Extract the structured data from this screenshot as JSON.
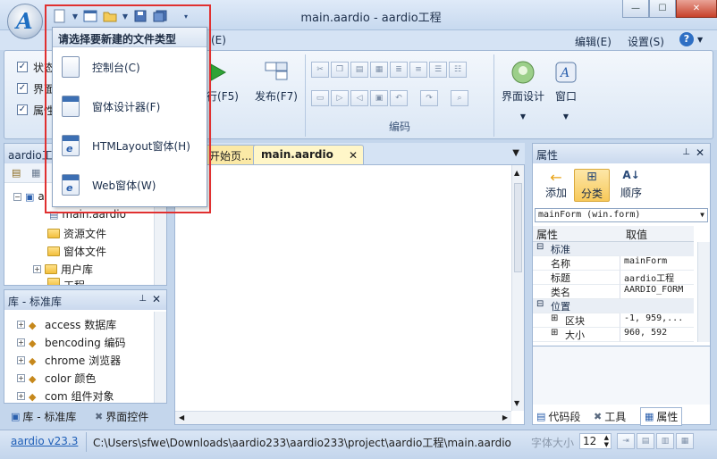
{
  "window": {
    "title": "main.aardio - aardio工程"
  },
  "menu_right": {
    "edit": "编辑(E)",
    "settings": "设置(S)",
    "help_icon": "help-icon"
  },
  "menu_partial": "(E)",
  "ribbon": {
    "view_checks": [
      {
        "label": "状态",
        "checked": true
      },
      {
        "label": "界面",
        "checked": true
      },
      {
        "label": "属性",
        "checked": true
      }
    ],
    "run_label": "运行(F5)",
    "publish_label": "发布(F7)",
    "code_group_label": "编码",
    "ui_design_label": "界面设计",
    "window_label": "窗口"
  },
  "new_dropdown": {
    "header": "请选择要新建的文件类型",
    "items": [
      {
        "label": "控制台(C)",
        "icon": "console-icon"
      },
      {
        "label": "窗体设计器(F)",
        "icon": "form-designer-icon"
      },
      {
        "label": "HTMLayout窗体(H)",
        "icon": "htmlayout-icon"
      },
      {
        "label": "Web窗体(W)",
        "icon": "web-form-icon"
      }
    ]
  },
  "project_panel": {
    "title": "aardio工",
    "tree": [
      {
        "label": "a",
        "type": "project"
      },
      {
        "label": "main.aardio",
        "type": "file"
      },
      {
        "label": "资源文件",
        "type": "folder"
      },
      {
        "label": "窗体文件",
        "type": "folder"
      },
      {
        "label": "用户库",
        "type": "folder"
      },
      {
        "label": "工程",
        "type": "folder"
      }
    ]
  },
  "library_panel": {
    "title": "库 - 标准库",
    "items": [
      {
        "label": "access 数据库"
      },
      {
        "label": "bencoding 编码"
      },
      {
        "label": "chrome 浏览器"
      },
      {
        "label": "color 颜色"
      },
      {
        "label": "com 组件对象"
      }
    ],
    "bottom_tabs": [
      {
        "label": "库 - 标准库",
        "icon": "library-icon"
      },
      {
        "label": "界面控件",
        "icon": "controls-icon"
      }
    ]
  },
  "editor": {
    "tabs": [
      {
        "label": "开始页...",
        "active": false
      },
      {
        "label": "main.aardio",
        "active": true
      }
    ]
  },
  "properties": {
    "title": "属性",
    "tools": [
      {
        "label": "添加",
        "icon": "add-arrow-icon"
      },
      {
        "label": "分类",
        "icon": "categorize-icon"
      },
      {
        "label": "顺序",
        "icon": "sort-az-icon"
      }
    ],
    "object_select": "mainForm (win.form)",
    "col_name": "属性",
    "col_value": "取值",
    "rows": [
      {
        "kind": "category",
        "name": "标准"
      },
      {
        "kind": "prop",
        "name": "名称",
        "value": "mainForm"
      },
      {
        "kind": "prop",
        "name": "标题",
        "value": "aardio工程"
      },
      {
        "kind": "prop",
        "name": "类名",
        "value": "AARDIO_FORM"
      },
      {
        "kind": "category",
        "name": "位置"
      },
      {
        "kind": "prop",
        "name": "区块",
        "value": "-1, 959,..."
      },
      {
        "kind": "prop",
        "name": "大小",
        "value": "960, 592"
      }
    ],
    "bottom_tabs": [
      {
        "label": "代码段",
        "icon": "snippet-icon"
      },
      {
        "label": "工具",
        "icon": "tools-icon"
      },
      {
        "label": "属性",
        "icon": "properties-icon"
      }
    ]
  },
  "statusbar": {
    "version": "aardio v23.3",
    "path": "C:\\Users\\sfwe\\Downloads\\aardio233\\aardio233\\project\\aardio工程\\main.aardio",
    "font_size_label": "字体大小",
    "font_size_value": "12"
  }
}
